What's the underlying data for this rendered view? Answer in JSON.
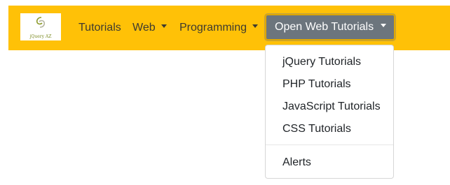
{
  "navbar": {
    "background": "#ffc107",
    "brand": {
      "logo_text": "jQuery AZ",
      "logo_color": "#7a8a20"
    },
    "items": [
      {
        "label": "Tutorials",
        "has_dropdown": false
      },
      {
        "label": "Web",
        "has_dropdown": true
      },
      {
        "label": "Programming",
        "has_dropdown": true
      }
    ],
    "active_dropdown": {
      "label": "Open Web Tutorials",
      "background": "#6c757d",
      "expanded": true
    }
  },
  "dropdown_menu": {
    "items": [
      {
        "label": "jQuery Tutorials"
      },
      {
        "label": "PHP Tutorials"
      },
      {
        "label": "JavaScript Tutorials"
      },
      {
        "label": "CSS Tutorials"
      }
    ],
    "after_divider": [
      {
        "label": "Alerts"
      }
    ]
  },
  "icons": {
    "caret": "caret-down-icon",
    "logo": "jquery-az-logo"
  }
}
